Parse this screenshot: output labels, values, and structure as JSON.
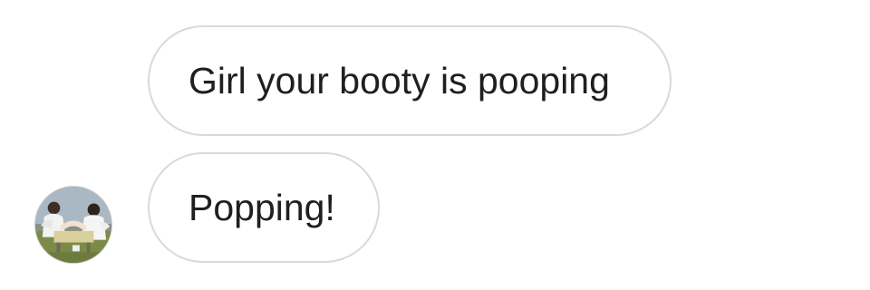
{
  "conversation": {
    "messages": [
      {
        "text": "Girl your booty is pooping"
      },
      {
        "text": "Popping!"
      }
    ]
  },
  "avatar": {
    "kind": "profile-photo",
    "description_colors": {
      "sky": "#a9b8c2",
      "ground": "#7b8b47",
      "clothing": "#f2f2f2",
      "table": "#d8cf9c"
    }
  }
}
